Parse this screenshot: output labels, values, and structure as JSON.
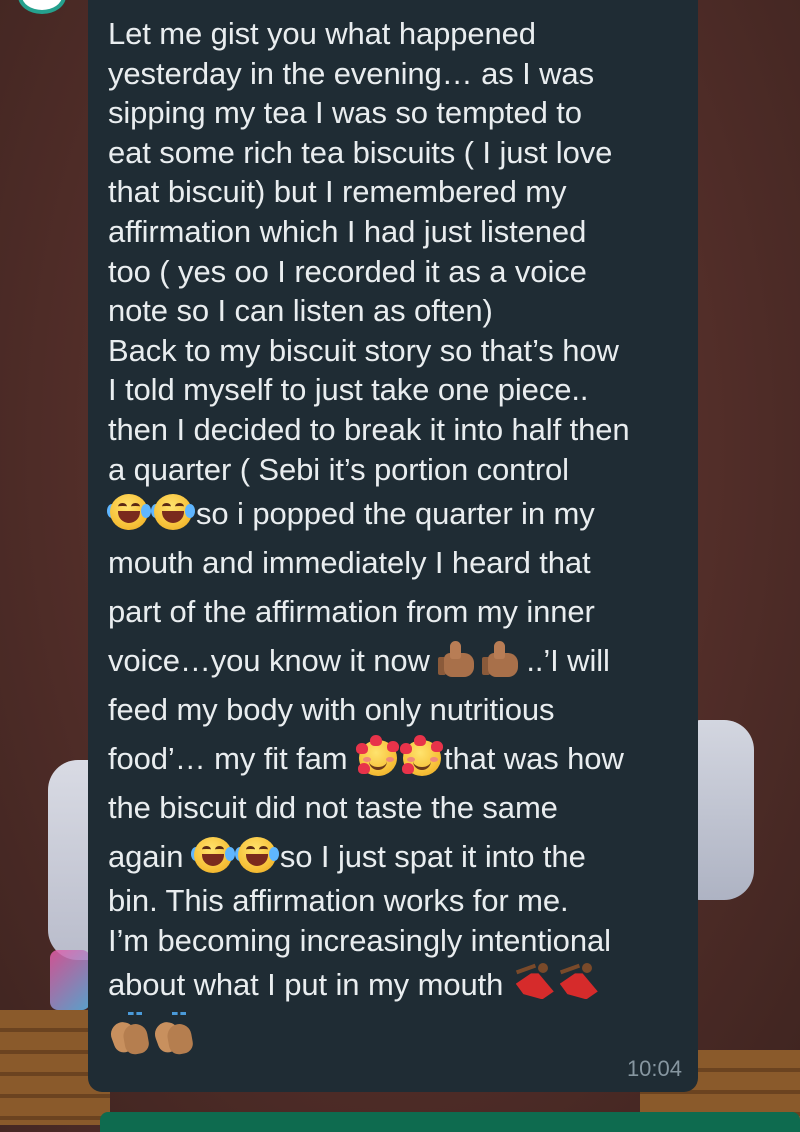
{
  "message": {
    "lines": [
      "Let me gist you what happened",
      "yesterday in the evening… as I was",
      "sipping my tea I was so tempted to",
      "eat some rich tea biscuits ( I just love",
      "that biscuit) but I remembered my",
      "affirmation which I had just listened",
      "too ( yes oo I recorded it as a voice",
      "note so I can listen as often)",
      "Back to my biscuit story so that’s how",
      "I told myself to just take one piece..",
      "then I decided to break it into half then",
      "a quarter ( Sebi it’s portion control"
    ],
    "line_popped": "so i popped the quarter in my",
    "line_mouth": "mouth and immediately I heard that",
    "line_part": "part of the affirmation from my inner",
    "line_voice_a": "voice…you know it now ",
    "line_voice_b": "..’I will",
    "line_feed": "feed my body with only nutritious",
    "line_food_a": "food’… my fit fam ",
    "line_food_b": "that was how",
    "line_biscuit": "the biscuit did not taste the same",
    "line_again_a": "again ",
    "line_again_b": "so I just spat it into the",
    "line_bin": "bin. This affirmation works for me.",
    "line_becoming": "I’m becoming increasingly intentional",
    "line_about": "about what I put in my mouth ",
    "emojis": {
      "laugh": "face-with-tears-of-joy-icon",
      "thumbs": "thumbs-up-medium-dark-icon",
      "hearts": "smiling-face-with-hearts-icon",
      "dancer": "woman-dancing-icon",
      "clap": "clapping-hands-icon"
    },
    "time": "10:04"
  },
  "colors": {
    "bubble": "#1f2c34",
    "text": "#e9edef",
    "time": "#8696a0",
    "background": "#57302b",
    "accent": "#25a18e"
  }
}
